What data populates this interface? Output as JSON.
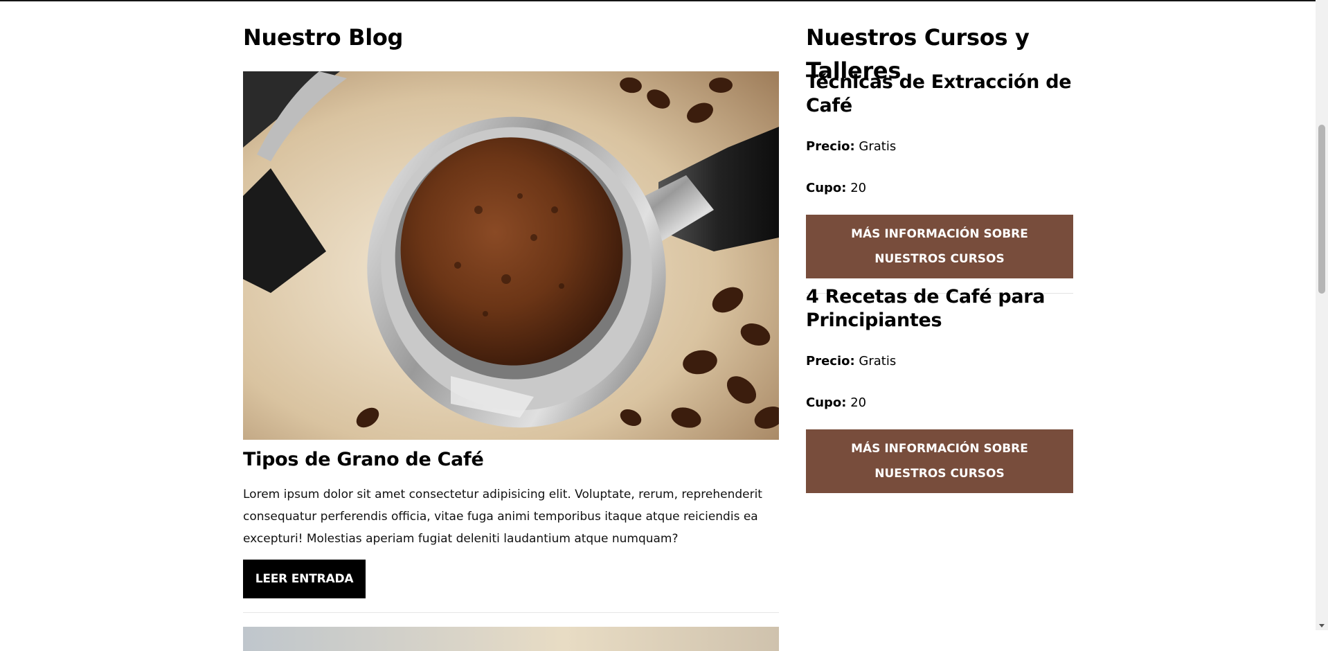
{
  "blog": {
    "heading": "Nuestro Blog",
    "post": {
      "title": "Tipos de Grano de Café",
      "excerpt": "Lorem ipsum dolor sit amet consectetur adipisicing elit. Voluptate, rerum, reprehenderit consequatur perferendis officia, vitae fuga animi temporibus itaque atque reiciendis ea excepturi! Molestias aperiam fugiat deleniti laudantium atque numquam?",
      "button_label": "LEER ENTRADA",
      "image_icon": "coffee-portafilter-image"
    }
  },
  "courses": {
    "heading": "Nuestros Cursos y Talleres",
    "items": [
      {
        "title": "Técnicas de Extracción de Café",
        "price_label": "Precio:",
        "price_value": "Gratis",
        "capacity_label": "Cupo:",
        "capacity_value": "20",
        "button_label": "Más Información sobre nuestros cursos"
      },
      {
        "title": "4 Recetas de Café para Principiantes",
        "price_label": "Precio:",
        "price_value": "Gratis",
        "capacity_label": "Cupo:",
        "capacity_value": "20",
        "button_label": "Más Información sobre nuestros cursos"
      }
    ]
  },
  "colors": {
    "course_button": "#784d3c",
    "blog_button": "#000000"
  }
}
